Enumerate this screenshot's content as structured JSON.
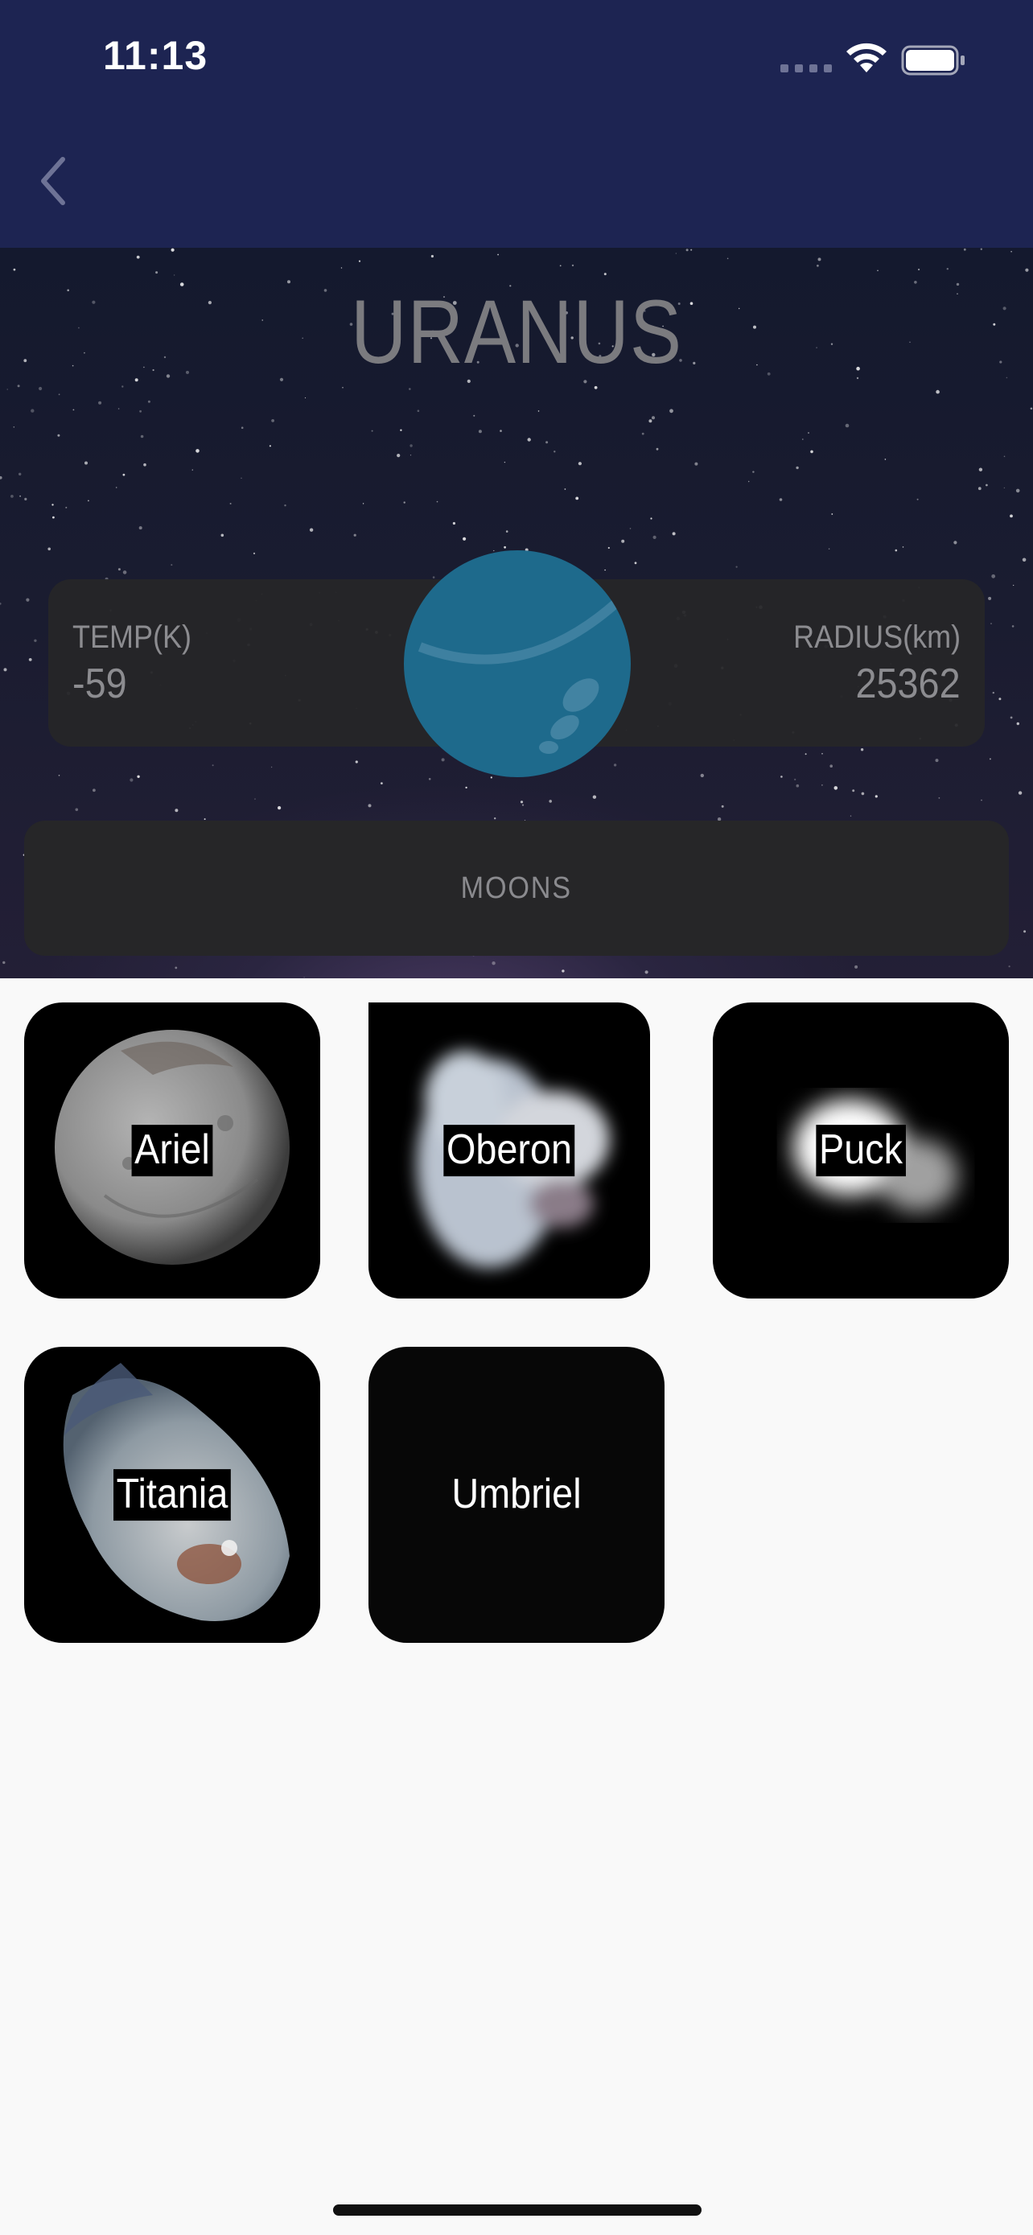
{
  "status_bar": {
    "time": "11:13"
  },
  "nav": {
    "back_icon": "chevron-left-icon"
  },
  "planet": {
    "name": "URANUS",
    "temp_label": "TEMP(K)",
    "temp_value": "-59",
    "radius_label": "RADIUS(km)",
    "radius_value": "25362",
    "color": "#1e6a8c"
  },
  "moons_button": {
    "label": "MOONS"
  },
  "moons": [
    {
      "name": "Ariel"
    },
    {
      "name": "Oberon"
    },
    {
      "name": "Puck"
    },
    {
      "name": "Titania"
    },
    {
      "name": "Umbriel"
    }
  ],
  "colors": {
    "header": "#1d2452",
    "card": "#262628",
    "background": "#f9f9f9"
  }
}
